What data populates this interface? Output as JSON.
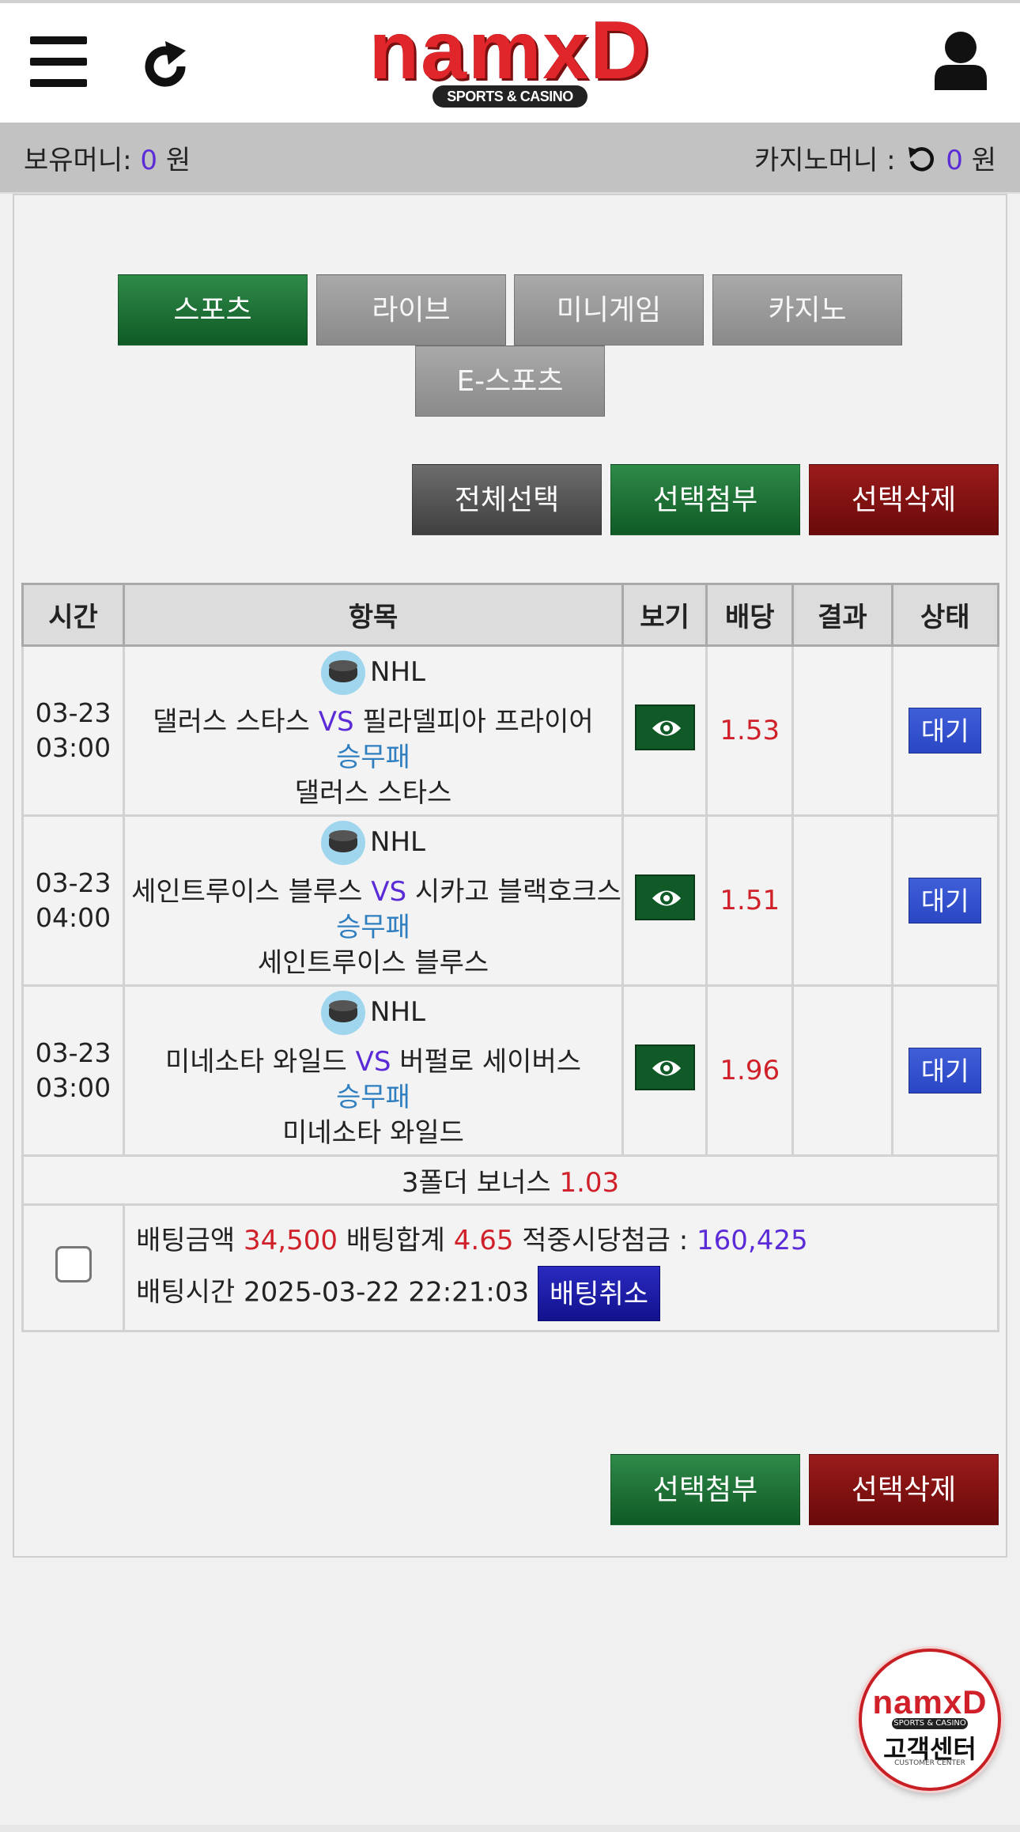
{
  "header": {
    "logo_text": "namxD",
    "logo_sub": "SPORTS & CASINO"
  },
  "balance": {
    "money_label": "보유머니:",
    "money_value": "0",
    "money_unit": "원",
    "casino_label": "카지노머니 :",
    "casino_value": "0",
    "casino_unit": "원"
  },
  "tabs": [
    "스포츠",
    "라이브",
    "미니게임",
    "카지노",
    "E-스포츠"
  ],
  "actions": {
    "select_all": "전체선택",
    "attach_selected": "선택첨부",
    "delete_selected": "선택삭제"
  },
  "table": {
    "headers": [
      "시간",
      "항목",
      "보기",
      "배당",
      "결과",
      "상태"
    ],
    "rows": [
      {
        "date": "03-23",
        "time": "03:00",
        "league": "NHL",
        "home": "댈러스 스타스",
        "vs": "VS",
        "away": "필라델피아 프라이어",
        "market": "승무패",
        "pick": "댈러스 스타스",
        "odds": "1.53",
        "result": "",
        "status": "대기"
      },
      {
        "date": "03-23",
        "time": "04:00",
        "league": "NHL",
        "home": "세인트루이스 블루스",
        "vs": "VS",
        "away": "시카고 블랙호크스",
        "market": "승무패",
        "pick": "세인트루이스 블루스",
        "odds": "1.51",
        "result": "",
        "status": "대기"
      },
      {
        "date": "03-23",
        "time": "03:00",
        "league": "NHL",
        "home": "미네소타 와일드",
        "vs": "VS",
        "away": "버펄로 세이버스",
        "market": "승무패",
        "pick": "미네소타 와일드",
        "odds": "1.96",
        "result": "",
        "status": "대기"
      }
    ],
    "bonus_label": "3폴더 보너스",
    "bonus_value": "1.03"
  },
  "summary": {
    "bet_amount_label": "배팅금액",
    "bet_amount": "34,500",
    "total_odds_label": "배팅합계",
    "total_odds": "4.65",
    "payout_label": "적중시당첨금 :",
    "payout": "160,425",
    "bet_time_label": "배팅시간",
    "bet_time": "2025-03-22 22:21:03",
    "cancel_label": "배팅취소"
  },
  "support": {
    "logo_text": "namxD",
    "sub": "SPORTS & CASINO",
    "label": "고객센터",
    "tiny": "CUSTOMER CENTER"
  },
  "colors": {
    "accent_green": "#0f5a26",
    "accent_red": "#6a0a0a",
    "value_purple": "#5a2bd6",
    "odds_red": "#d0202a"
  }
}
